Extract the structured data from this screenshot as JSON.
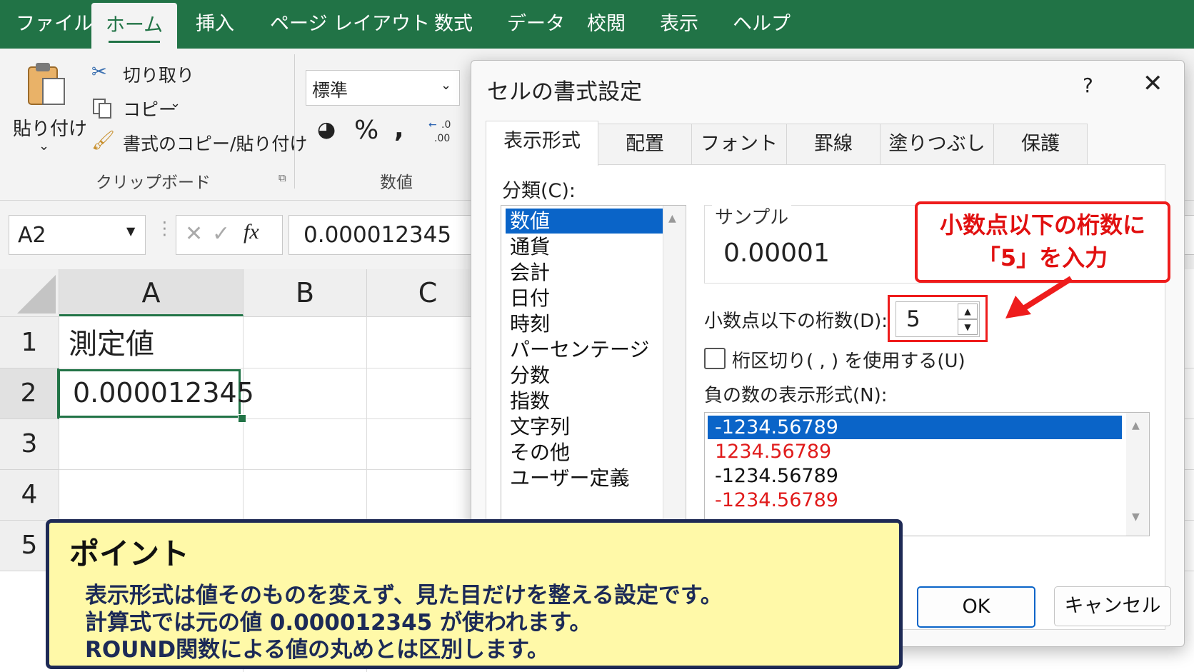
{
  "ribbon_tabs": [
    "ファイル",
    "ホーム",
    "挿入",
    "ページ レイアウト",
    "数式",
    "データ",
    "校閲",
    "表示",
    "ヘルプ"
  ],
  "clipboard": {
    "paste": "貼り付け",
    "cut": "切り取り",
    "copy": "コピー",
    "format_painter": "書式のコピー/貼り付け",
    "group": "クリップボード"
  },
  "number": {
    "format_value": "標準",
    "percent": "%",
    "comma": ",",
    "group": "数値"
  },
  "formula_bar": {
    "name_box": "A2",
    "fx": "fx",
    "value": "0.000012345"
  },
  "grid": {
    "columns": [
      "A",
      "B",
      "C"
    ],
    "rows": [
      "1",
      "2",
      "3",
      "4",
      "5"
    ],
    "a1": "測定値",
    "a2": "0.000012345"
  },
  "dialog": {
    "title": "セルの書式設定",
    "help": "?",
    "tabs": [
      "表示形式",
      "配置",
      "フォント",
      "罫線",
      "塗りつぶし",
      "保護"
    ],
    "category_label": "分類(C):",
    "categories": [
      "数値",
      "通貨",
      "会計",
      "日付",
      "時刻",
      "パーセンテージ",
      "分数",
      "指数",
      "文字列",
      "その他",
      "ユーザー定義"
    ],
    "sample_label": "サンプル",
    "sample_value": "0.00001",
    "decimals_label": "小数点以下の桁数(D):",
    "decimals_value": "5",
    "separator_label": "桁区切り( , ) を使用する(U)",
    "negative_label": "負の数の表示形式(N):",
    "negative_formats": [
      {
        "text": "-1234.56789",
        "color": "#ffffff"
      },
      {
        "text": "1234.56789",
        "color": "#e01b1b"
      },
      {
        "text": "-1234.56789",
        "color": "#111111"
      },
      {
        "text": "-1234.56789",
        "color": "#e01b1b"
      }
    ],
    "ok": "OK",
    "cancel": "キャンセル"
  },
  "callout": {
    "line1": "小数点以下の桁数に",
    "line2": "「5」を入力"
  },
  "point": {
    "heading": "ポイント",
    "line1": "表示形式は値そのものを変えず、見た目だけを整える設定です。",
    "line2": "計算式では元の値 0.000012345 が使われます。",
    "line3": "ROUND関数による値の丸めとは区別します。"
  },
  "colors": {
    "excel_green": "#217346",
    "highlight_blue": "#0a64c8",
    "callout_red": "#ee1c1c"
  }
}
